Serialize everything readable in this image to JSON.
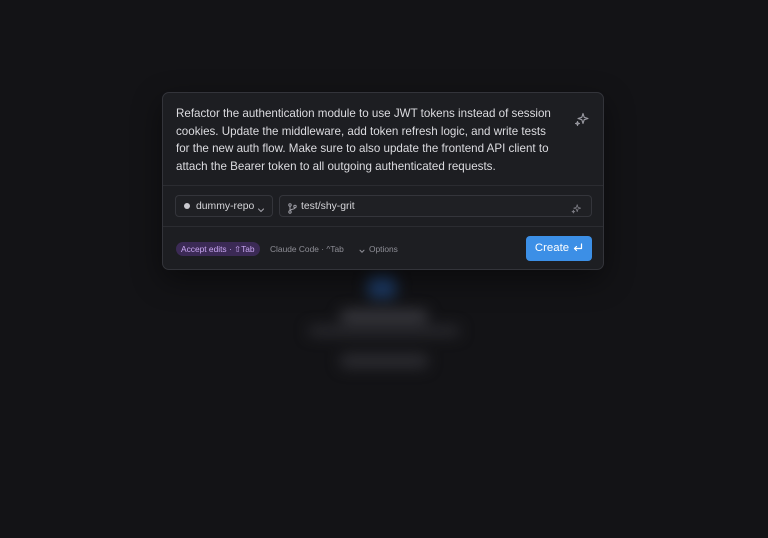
{
  "prompt": {
    "text": "Refactor the authentication module to use JWT tokens instead of session cookies. Update the middleware, add token refresh logic, and write tests for the new auth flow. Make sure to also update the frontend API client to attach the Bearer token to all outgoing authenticated requests."
  },
  "selectors": {
    "repo": "dummy-repo",
    "branch": "test/shy-grit"
  },
  "footer": {
    "accept_edits": "Accept edits · ⇧Tab",
    "claude_code": "Claude Code · ^Tab",
    "options": "Options",
    "create": "Create"
  },
  "icons": {
    "sparkle": "sparkle-icon",
    "chevron": "chevron-down-icon",
    "branch": "git-branch-icon",
    "enter": "enter-icon"
  },
  "colors": {
    "accent": "#3c8fe6",
    "badge_bg": "#3b2a55",
    "badge_text": "#c9a6f2"
  }
}
